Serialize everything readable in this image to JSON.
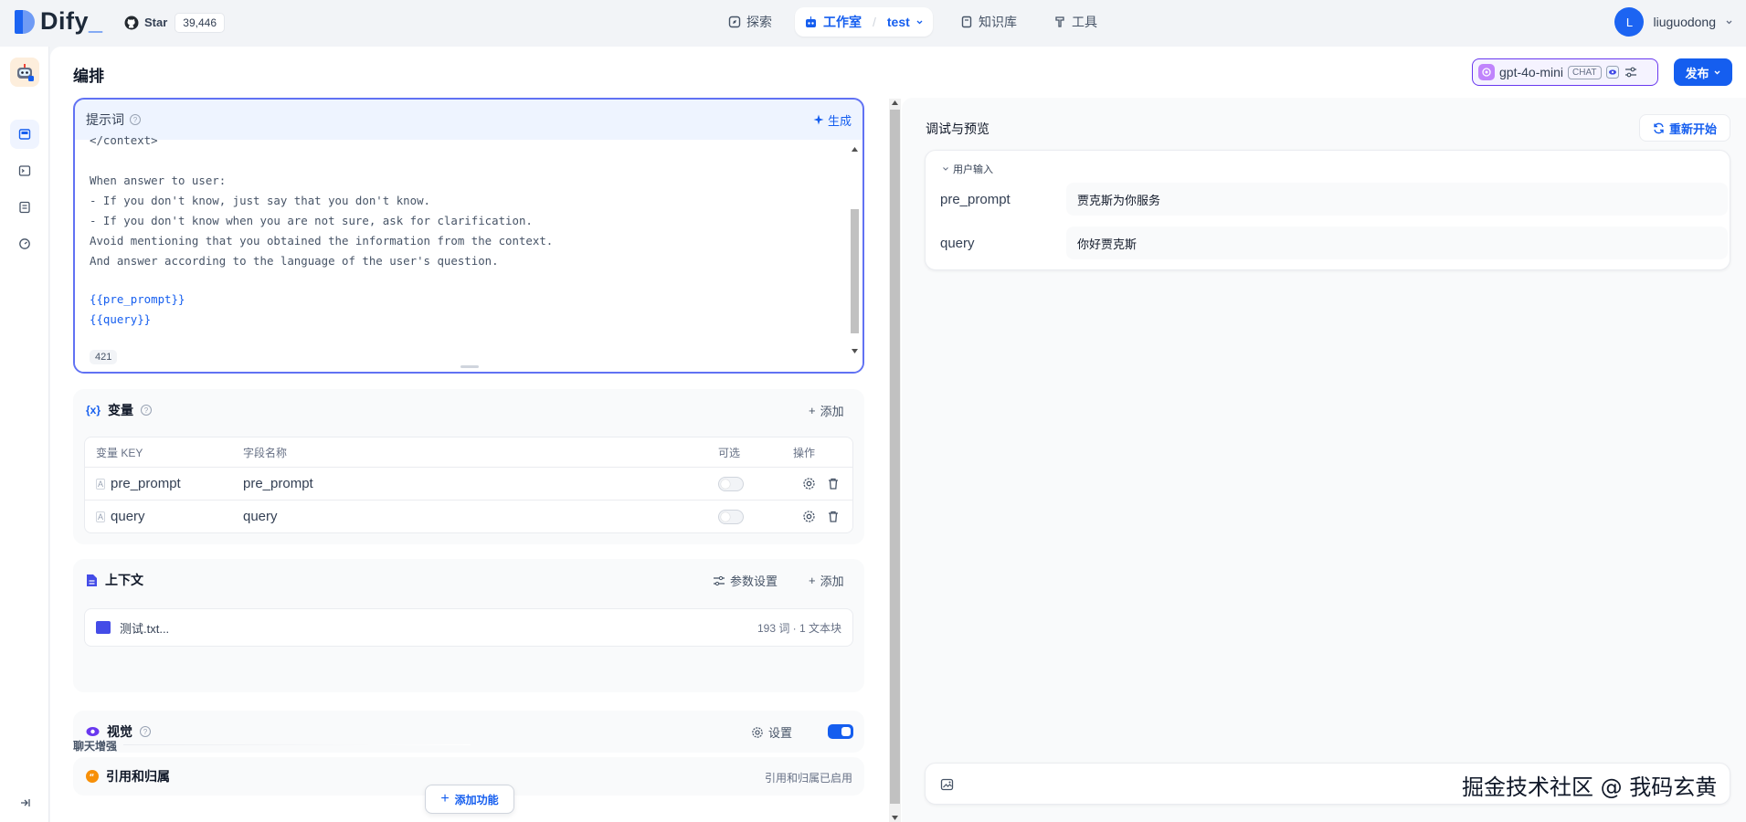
{
  "brand": {
    "name": "Dify",
    "suffix": "_"
  },
  "github": {
    "star_label": "Star",
    "star_count": "39,446"
  },
  "nav": {
    "explore": "探索",
    "studio": "工作室",
    "app_name": "test",
    "knowledge": "知识库",
    "tools": "工具"
  },
  "user": {
    "initial": "L",
    "name": "liuguodong"
  },
  "page": {
    "title": "编排"
  },
  "model": {
    "name": "gpt-4o-mini",
    "mode": "CHAT"
  },
  "publish": {
    "label": "发布"
  },
  "prompt": {
    "label": "提示词",
    "generate": "生成",
    "lines": [
      "</context>",
      "",
      "When answer to user:",
      "- If you don't know, just say that you don't know.",
      "- If you don't know when you are not sure, ask for clarification.",
      "Avoid mentioning that you obtained the information from the context.",
      "And answer according to the language of the user's question."
    ],
    "var_lines": [
      "{{pre_prompt}}",
      "{{query}}"
    ],
    "char_count": "421"
  },
  "variables": {
    "title": "变量",
    "add": "添加",
    "headers": {
      "key": "变量 KEY",
      "name": "字段名称",
      "optional": "可选",
      "actions": "操作"
    },
    "rows": [
      {
        "key": "pre_prompt",
        "name": "pre_prompt"
      },
      {
        "key": "query",
        "name": "query"
      }
    ]
  },
  "context": {
    "title": "上下文",
    "params": "参数设置",
    "add": "添加",
    "file": {
      "name": "测试.txt...",
      "meta": "193 词 · 1 文本块"
    }
  },
  "vision": {
    "title": "视觉",
    "settings": "设置"
  },
  "chat_enhance": {
    "title": "聊天增强",
    "citation": "引用和归属",
    "citation_status": "引用和归属已启用",
    "add_feature": "添加功能"
  },
  "debug": {
    "title": "调试与预览",
    "restart": "重新开始",
    "user_input_label": "用户输入",
    "inputs": [
      {
        "label": "pre_prompt",
        "value": "贾克斯为你服务"
      },
      {
        "label": "query",
        "value": "你好贾克斯"
      }
    ]
  },
  "watermark": "掘金技术社区 @ 我码玄黄",
  "colors": {
    "primary": "#155eef",
    "accent_purple": "#6938ef",
    "border": "#eaecf0"
  }
}
